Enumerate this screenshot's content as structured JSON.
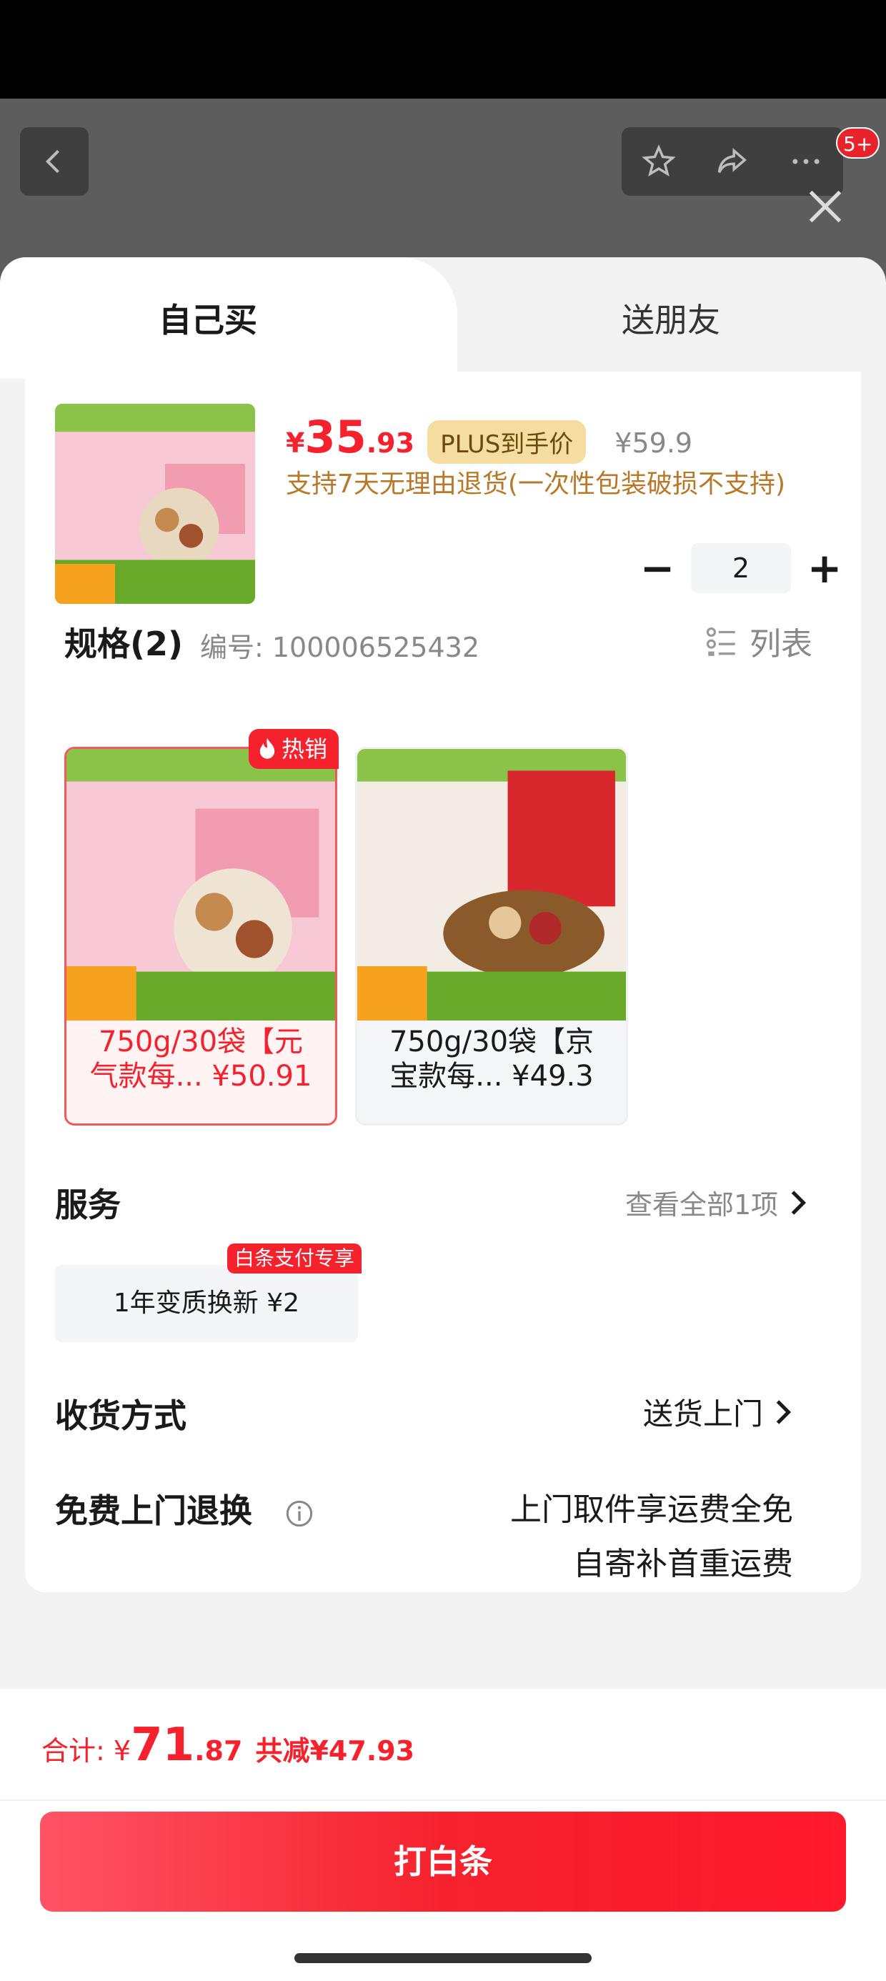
{
  "header": {
    "badge": "5+",
    "icons": [
      "back-icon",
      "star-icon",
      "share-icon",
      "more-icon",
      "close-icon"
    ]
  },
  "tabs": {
    "self": "自己买",
    "friend": "送朋友"
  },
  "product": {
    "price_symbol": "¥",
    "price_int": "35",
    "price_dec": ".93",
    "plus_label": "PLUS到手价",
    "original_price": "¥59.9",
    "return_note": "支持7天无理由退货(一次性包装破损不支持)",
    "quantity": "2",
    "qty_minus": "−",
    "qty_plus": "+"
  },
  "spec": {
    "title": "规格(2)",
    "code": "编号: 100006525432",
    "list_label": "列表",
    "hot_label": "热销",
    "variants": [
      {
        "line1": "750g/30袋【元",
        "line2": "气款每... ¥50.91",
        "selected": true
      },
      {
        "line1": "750g/30袋【京",
        "line2": "宝款每... ¥49.3",
        "selected": false
      }
    ]
  },
  "service": {
    "title": "服务",
    "view_all": "查看全部1项",
    "chip": "1年变质换新 ¥2",
    "chip_tag": "白条支付专享"
  },
  "delivery": {
    "title": "收货方式",
    "value": "送货上门"
  },
  "free_return": {
    "title": "免费上门退换",
    "line1": "上门取件享运费全免",
    "line2": "自寄补首重运费"
  },
  "footer": {
    "total_label": "合计: ¥",
    "total_int": "71",
    "total_dec": ".87",
    "discount": "共减¥47.93",
    "pay_button": "打白条"
  },
  "colors": {
    "accent": "#f5222d",
    "plus_tag_bg": "#f5dda1",
    "return_note": "#b8782a"
  }
}
